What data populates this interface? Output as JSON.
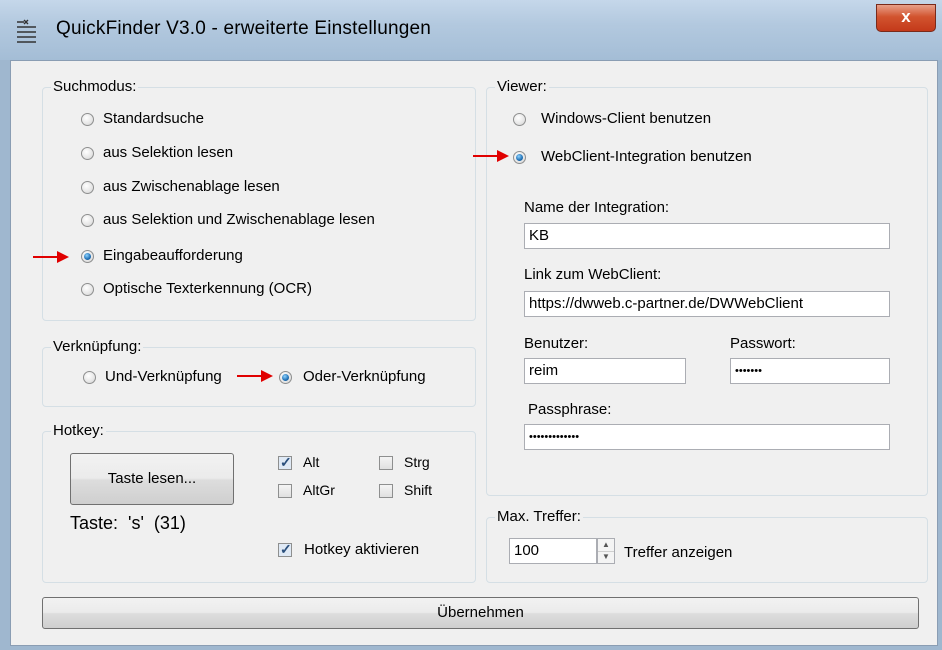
{
  "window": {
    "title": "QuickFinder V3.0 - erweiterte Einstellungen",
    "close_label": "x"
  },
  "suchmodus": {
    "label": "Suchmodus:",
    "options": [
      {
        "label": "Standardsuche",
        "selected": false
      },
      {
        "label": "aus Selektion lesen",
        "selected": false
      },
      {
        "label": "aus Zwischenablage lesen",
        "selected": false
      },
      {
        "label": "aus Selektion und Zwischenablage lesen",
        "selected": false
      },
      {
        "label": "Eingabeaufforderung",
        "selected": true
      },
      {
        "label": "Optische Texterkennung (OCR)",
        "selected": false
      }
    ]
  },
  "verknuepfung": {
    "label": "Verknüpfung:",
    "options": [
      {
        "label": "Und-Verknüpfung",
        "selected": false
      },
      {
        "label": "Oder-Verknüpfung",
        "selected": true
      }
    ]
  },
  "hotkey": {
    "label": "Hotkey:",
    "read_button": "Taste lesen...",
    "taste_text": "Taste:  's'  (31)",
    "modifiers": [
      {
        "label": "Alt",
        "checked": true
      },
      {
        "label": "Strg",
        "checked": false
      },
      {
        "label": "AltGr",
        "checked": false
      },
      {
        "label": "Shift",
        "checked": false
      }
    ],
    "activate": {
      "label": "Hotkey aktivieren",
      "checked": true
    }
  },
  "viewer": {
    "label": "Viewer:",
    "options": [
      {
        "label": "Windows-Client benutzen",
        "selected": false
      },
      {
        "label": "WebClient-Integration benutzen",
        "selected": true
      }
    ],
    "integration_name_label": "Name der Integration:",
    "integration_name_value": "KB",
    "link_label": "Link zum WebClient:",
    "link_value": "https://dwweb.c-partner.de/DWWebClient",
    "user_label": "Benutzer:",
    "user_value": "reim",
    "password_label": "Passwort:",
    "password_value": "•••••••",
    "passphrase_label": "Passphrase:",
    "passphrase_value": "•••••••••••••"
  },
  "max_treffer": {
    "label": "Max. Treffer:",
    "value": "100",
    "suffix": "Treffer anzeigen"
  },
  "apply_button": "Übernehmen",
  "colors": {
    "arrow": "#e00000",
    "radio_selected": "#1f6fb4"
  }
}
